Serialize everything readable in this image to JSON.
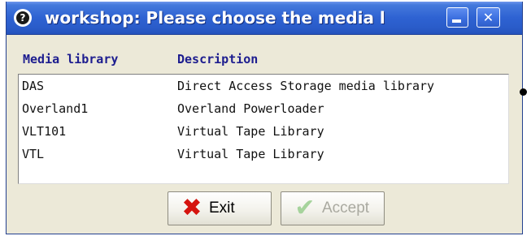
{
  "window": {
    "title": "workshop: Please choose the media l",
    "icon": "question-mark-icon",
    "icon_glyph": "?",
    "minimize_icon": "minimize-icon",
    "close_icon": "close-icon",
    "close_glyph": "✕",
    "titlebar_color": "#2a5cc9"
  },
  "table": {
    "columns": [
      "Media library",
      "Description"
    ],
    "rows": [
      {
        "name": "DAS",
        "description": "Direct Access Storage media library"
      },
      {
        "name": "Overland1",
        "description": "Overland Powerloader"
      },
      {
        "name": "VLT101",
        "description": "Virtual Tape Library"
      },
      {
        "name": "VTL",
        "description": "Virtual Tape Library"
      }
    ],
    "header_color": "#1d1d8f"
  },
  "buttons": {
    "exit": {
      "label": "Exit",
      "icon": "x-icon",
      "icon_glyph": "✖",
      "enabled": true
    },
    "accept": {
      "label": "Accept",
      "icon": "check-icon",
      "icon_glyph": "✔",
      "enabled": false
    }
  }
}
